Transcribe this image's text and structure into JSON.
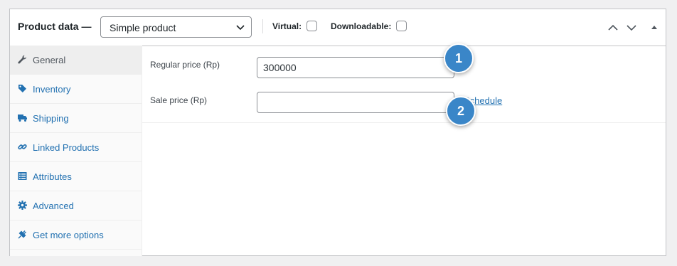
{
  "header": {
    "title": "Product data —",
    "product_type": "Simple product",
    "virtual_label": "Virtual:",
    "downloadable_label": "Downloadable:",
    "virtual_checked": false,
    "downloadable_checked": false
  },
  "tabs": [
    {
      "label": "General",
      "icon": "wrench-icon",
      "active": true
    },
    {
      "label": "Inventory",
      "icon": "tag-icon",
      "active": false
    },
    {
      "label": "Shipping",
      "icon": "truck-icon",
      "active": false
    },
    {
      "label": "Linked Products",
      "icon": "link-icon",
      "active": false
    },
    {
      "label": "Attributes",
      "icon": "list-icon",
      "active": false
    },
    {
      "label": "Advanced",
      "icon": "gear-icon",
      "active": false
    },
    {
      "label": "Get more options",
      "icon": "plugin-icon",
      "active": false
    }
  ],
  "general": {
    "regular_price_label": "Regular price (Rp)",
    "regular_price_value": "300000",
    "sale_price_label": "Sale price (Rp)",
    "sale_price_value": "",
    "schedule_link": "Schedule"
  },
  "annotations": [
    "1",
    "2"
  ],
  "colors": {
    "link": "#2271b1",
    "badge": "#3a86c8"
  }
}
